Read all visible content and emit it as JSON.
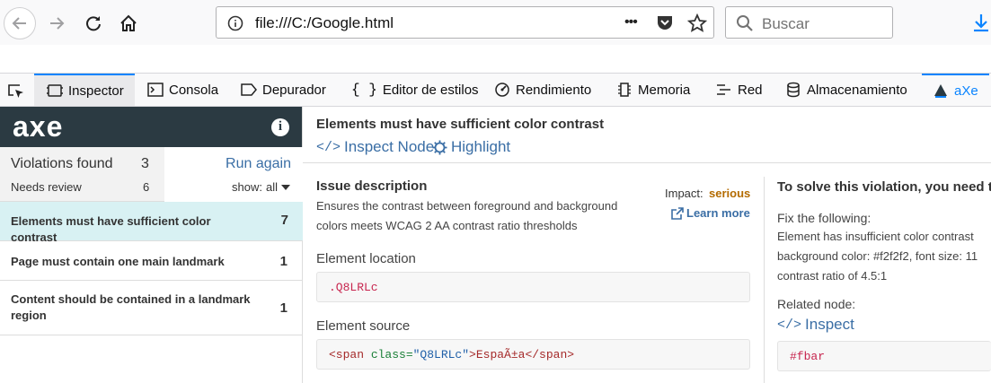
{
  "browser": {
    "url": "file:///C:/Google.html",
    "search_placeholder": "Buscar",
    "more_label": "•••"
  },
  "devtools": {
    "tabs": [
      "Inspector",
      "Consola",
      "Depurador",
      "Editor de estilos",
      "Rendimiento",
      "Memoria",
      "Red",
      "Almacenamiento",
      "aXe"
    ]
  },
  "axe": {
    "logo": "axe",
    "info_label": "i",
    "violations_label": "Violations found",
    "violations_count": "3",
    "review_label": "Needs review",
    "review_count": "6",
    "run_again": "Run again",
    "show_label": "show:",
    "show_value": "all",
    "rules": [
      {
        "label": "Elements must have sufficient color contrast",
        "count": "7"
      },
      {
        "label": "Page must contain one main landmark",
        "count": "1"
      },
      {
        "label": "Content should be contained in a landmark region",
        "count": "1"
      }
    ]
  },
  "detail": {
    "title": "Elements must have sufficient color contrast",
    "inspect_node": "Inspect Node",
    "highlight": "Highlight",
    "issue_heading": "Issue description",
    "issue_text_1": "Ensures the contrast between foreground and background",
    "issue_text_2": "colors meets WCAG 2 AA contrast ratio thresholds",
    "impact_label": "Impact:",
    "impact_value": "serious",
    "learn_more": "Learn more",
    "location_label": "Element location",
    "location_value": ".Q8LRLc",
    "source_label": "Element source",
    "source_tag_open": "<span ",
    "source_attr": "class=",
    "source_attr_val": "\"Q8LRLc\"",
    "source_text": ">EspaÃ±a</span>",
    "solve_heading": "To solve this violation, you need t",
    "fix_label": "Fix the following:",
    "fix_line_1": "Element has insufficient color contrast",
    "fix_line_2": "background color: #f2f2f2, font size: 11",
    "fix_line_3": "contrast ratio of 4.5:1",
    "related_label": "Related node:",
    "inspect": "Inspect",
    "related_value": "#fbar"
  },
  "colors": {
    "accent": "#0a84ff",
    "axe_header": "#2b3a42",
    "selected_rule": "#d8f1f3",
    "impact_serious": "#b36b00",
    "link": "#3a6ea5",
    "code_red": "#c7254e"
  }
}
